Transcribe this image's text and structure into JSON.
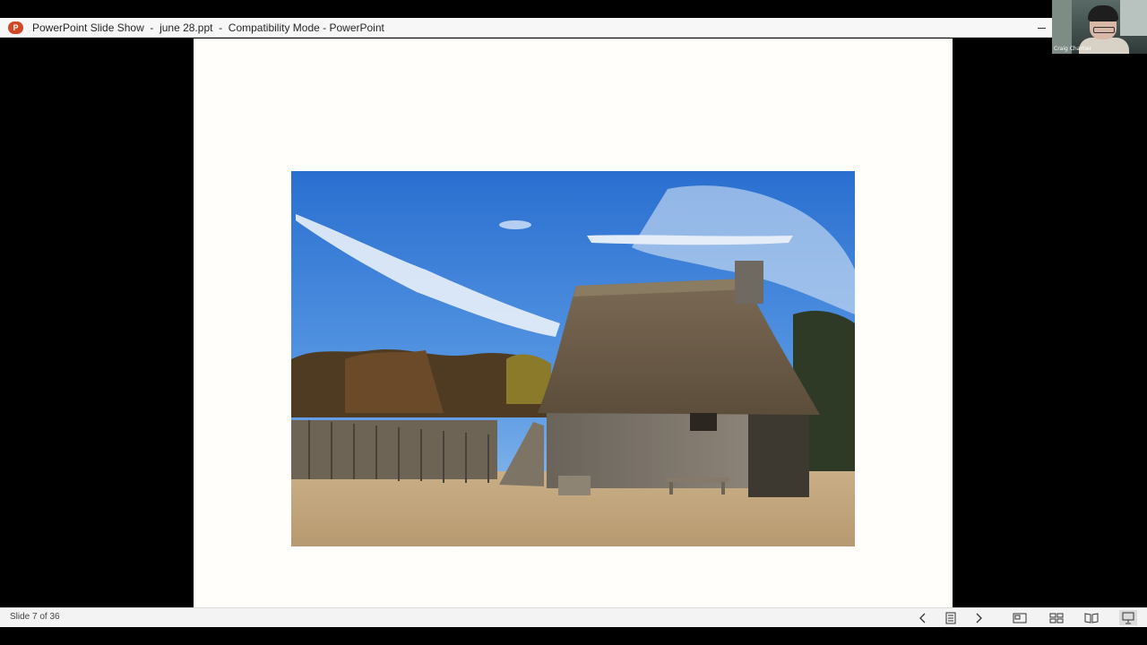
{
  "titlebar": {
    "app_icon_letter": "P",
    "title": "PowerPoint Slide Show  -  june 28.ppt  -  Compatibility Mode - PowerPoint"
  },
  "webcam": {
    "participant_name": "Craig Chartier"
  },
  "slide": {
    "image_description": "thatched-roof-house"
  },
  "statusbar": {
    "slide_count": "Slide 7 of 36",
    "icons": [
      "chevron-left-icon",
      "notes-icon",
      "chevron-right-icon",
      "normal-view-icon",
      "slide-sorter-icon",
      "reading-view-icon",
      "slideshow-icon"
    ]
  },
  "colors": {
    "accent": "#d24726",
    "status_bg": "#f3f3f3"
  }
}
